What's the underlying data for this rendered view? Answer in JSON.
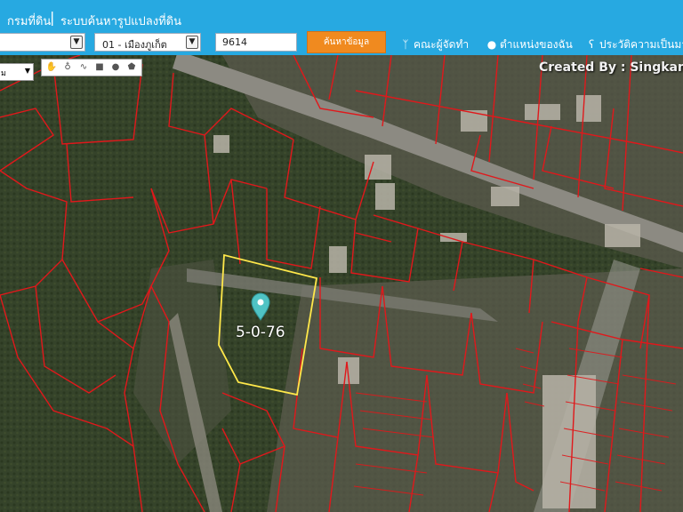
{
  "header": {
    "department": "กรมที่ดิน",
    "separator": "|",
    "system_title": "ระบบค้นหารูปแปลงที่ดิน",
    "province_select": {
      "value": ""
    },
    "district_select": {
      "value": "01 - เมืองภูเก็ต"
    },
    "parcel_number": {
      "value": "9614"
    },
    "search_button": "ค้นหาข้อมูล",
    "nav": [
      {
        "label": "คณะผู้จัดทำ",
        "icon": "antenna-icon"
      },
      {
        "label": "ตำแหน่งของฉัน",
        "icon": "person-icon"
      },
      {
        "label": "ประวัติความเป็นมา",
        "icon": "history-icon"
      }
    ]
  },
  "map": {
    "credit": "Created By : Singkam",
    "layer_select": {
      "value": "ม"
    },
    "toolbar": [
      "hand-icon",
      "marker-icon",
      "polyline-icon",
      "rectangle-icon",
      "circle-icon",
      "polygon-icon"
    ],
    "selected_parcel": {
      "label": "5-0-76",
      "outline_color": "#ffe84a",
      "marker_color": "#4fc3c4"
    },
    "parcel_line_color": "#e0181b",
    "header_color": "#27a9e1",
    "search_button_color": "#f08a1f"
  }
}
